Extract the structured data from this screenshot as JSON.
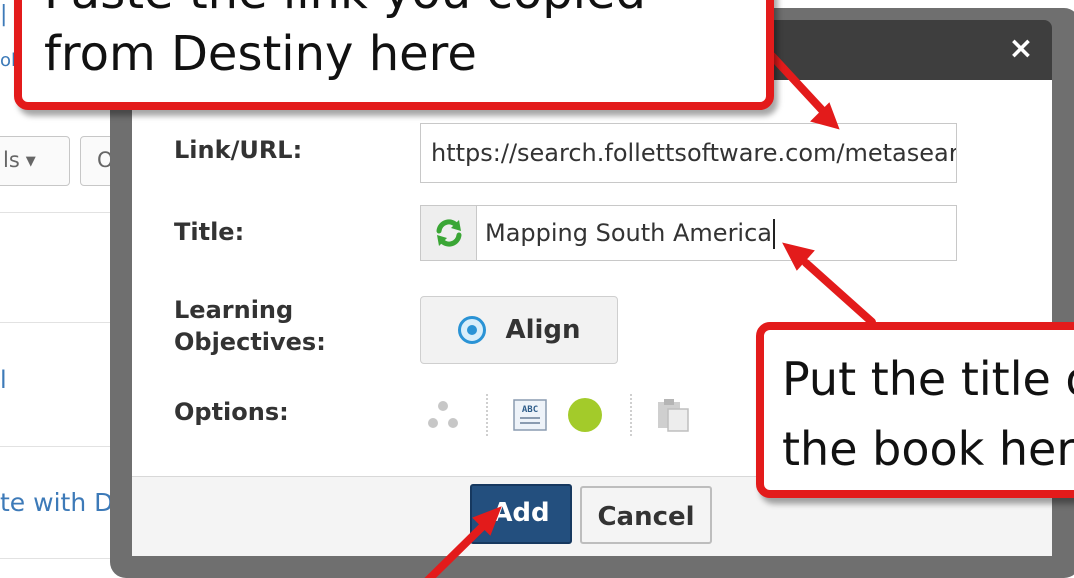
{
  "background": {
    "link_fragment_top": "|",
    "link_fragment_mid": "ol",
    "tools_menu_label": "ls",
    "options_button_fragment": "Op",
    "list_item_fragment": "l",
    "collaborate_fragment": "te with DE"
  },
  "dialog": {
    "close_label": "×",
    "fields": {
      "link_label": "Link/URL:",
      "link_value": "https://search.follettsoftware.com/metasearch",
      "title_label": "Title:",
      "title_value": "Mapping South America",
      "objectives_label_line1": "Learning",
      "objectives_label_line2": "Objectives:",
      "align_button_label": "Align",
      "options_label": "Options:"
    },
    "options_icons": [
      "group-icon",
      "abc-text-icon",
      "green-circle-icon",
      "clipboard-icon"
    ],
    "footer": {
      "add_label": "Add",
      "cancel_label": "Cancel"
    }
  },
  "callouts": {
    "top_line1": "Paste the link you copied",
    "top_line2": "from Destiny here",
    "right_line1": "Put the title of",
    "right_line2": "the book here"
  },
  "colors": {
    "callout_border": "#e31b1b",
    "primary_button": "#234f7e",
    "link_text": "#3d7ab8",
    "modal_header": "#3e3e3e",
    "status_green": "#a3cb2a"
  }
}
